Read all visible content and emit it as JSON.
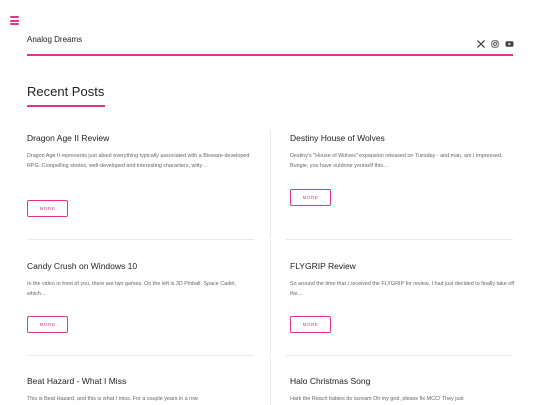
{
  "header": {
    "site_title": "Analog Dreams",
    "social": [
      {
        "icon": "x-twitter-icon"
      },
      {
        "icon": "instagram-icon"
      },
      {
        "icon": "youtube-icon"
      }
    ]
  },
  "colors": {
    "accent": "#e1338f"
  },
  "recent_posts": {
    "title": "Recent Posts",
    "more_label": "MORE",
    "posts": [
      {
        "title": "Dragon Age II Review",
        "excerpt": "Dragon Age II represents just about everything typically associated with a Bioware-developed RPG. Compelling stories, well-developed and interesting characters, witty…"
      },
      {
        "title": "Destiny House of Wolves",
        "excerpt": "Destiny's \"House of Wolves\" expansion released on Tuesday - and man, am I impressed. Bungie, you have outdone yourself this…"
      },
      {
        "title": "Candy Crush on Windows 10",
        "excerpt": "In the video in front of you, there are two games. On the left is 3D Pinball: Space Cadet, which…"
      },
      {
        "title": "FLYGRIP Review",
        "excerpt": "So around the time that I received the FLYGRIP for review, I had just decided to finally take off the…"
      },
      {
        "title": "Beat Hazard - What I Miss",
        "excerpt": "This is Beat Hazard, and this is what I miss. For a couple years in a row"
      },
      {
        "title": "Halo Christmas Song",
        "excerpt": "Hark the Reach babies do scream Oh my god, please fix MCC! They just"
      }
    ]
  }
}
